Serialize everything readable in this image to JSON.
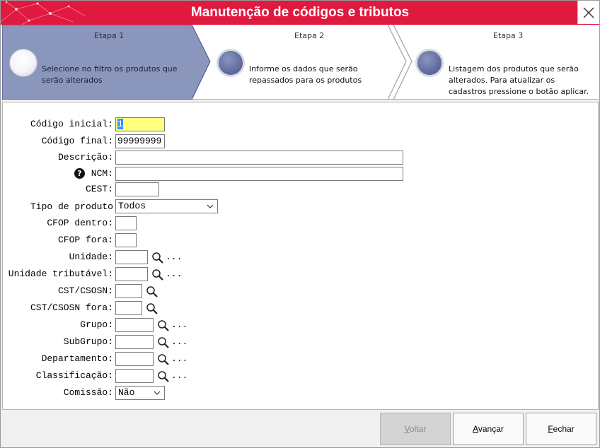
{
  "window": {
    "title": "Manutenção de códigos e tributos",
    "close_icon": "close-icon",
    "accent_color": "#e0193f"
  },
  "steps": [
    {
      "title": "Etapa 1",
      "description": "Selecione no filtro os produtos que serão alterados",
      "active": true
    },
    {
      "title": "Etapa 2",
      "description": "Informe os dados que serão repassados para os produtos",
      "active": false
    },
    {
      "title": "Etapa 3",
      "description": "Listagem dos produtos que serão alterados. Para atualizar os cadastros pressione o botão aplicar.",
      "active": false
    }
  ],
  "form": {
    "codigo_inicial": {
      "label": "Código inicial:",
      "value": "1"
    },
    "codigo_final": {
      "label": "Código final:",
      "value": "99999999"
    },
    "descricao": {
      "label": "Descrição:",
      "value": ""
    },
    "ncm": {
      "label": "NCM:",
      "value": "",
      "help_icon": "?"
    },
    "cest": {
      "label": "CEST:",
      "value": ""
    },
    "tipo_produto": {
      "label": "Tipo de produto",
      "selected": "Todos"
    },
    "cfop_dentro": {
      "label": "CFOP dentro:",
      "value": ""
    },
    "cfop_fora": {
      "label": "CFOP fora:",
      "value": ""
    },
    "unidade": {
      "label": "Unidade:",
      "value": "",
      "more": "..."
    },
    "unidade_tributavel": {
      "label": "Unidade tributável:",
      "value": "",
      "more": "..."
    },
    "cst_csosn": {
      "label": "CST/CSOSN:",
      "value": ""
    },
    "cst_csosn_fora": {
      "label": "CST/CSOSN fora:",
      "value": ""
    },
    "grupo": {
      "label": "Grupo:",
      "value": "",
      "more": "..."
    },
    "subgrupo": {
      "label": "SubGrupo:",
      "value": "",
      "more": "..."
    },
    "departamento": {
      "label": "Departamento:",
      "value": "",
      "more": "..."
    },
    "classificacao": {
      "label": "Classificação:",
      "value": "",
      "more": "..."
    },
    "comissao": {
      "label": "Comissão:",
      "selected": "Não"
    }
  },
  "buttons": {
    "voltar": {
      "prefix": "",
      "mnemonic": "V",
      "rest": "oltar",
      "enabled": false
    },
    "avancar": {
      "prefix": "",
      "mnemonic": "A",
      "rest": "vançar",
      "enabled": true
    },
    "fechar": {
      "prefix": "",
      "mnemonic": "F",
      "rest": "echar",
      "enabled": true
    }
  }
}
